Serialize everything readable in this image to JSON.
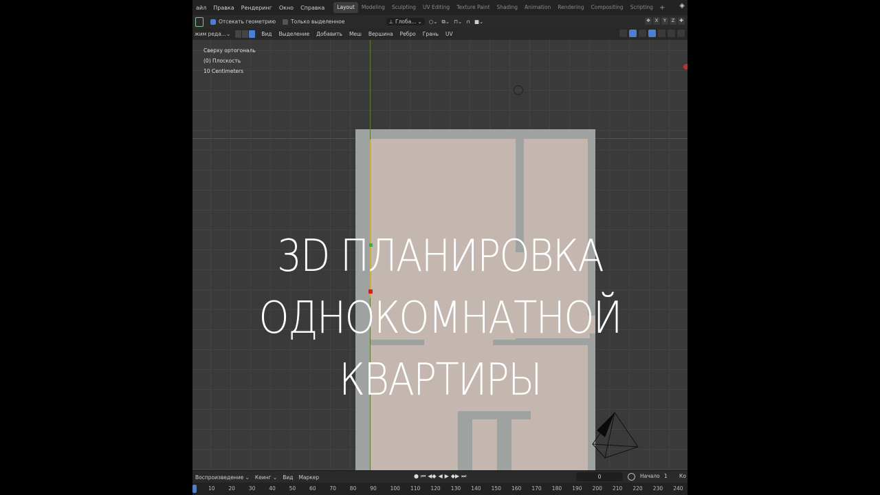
{
  "menubar": {
    "items": [
      "айл",
      "Правка",
      "Рендеринг",
      "Окно",
      "Справка"
    ],
    "workspaces": [
      "Layout",
      "Modeling",
      "Sculpting",
      "UV Editing",
      "Texture Paint",
      "Shading",
      "Animation",
      "Rendering",
      "Compositing",
      "Scripting"
    ],
    "active_workspace": "Layout",
    "add": "+"
  },
  "toolbar": {
    "clip_geometry": "Отсекать геометрию",
    "only_selected": "Только выделенное",
    "orientation": "Глоба..."
  },
  "viewport_header": {
    "mode": "жим реда...",
    "menus": [
      "Вид",
      "Выделение",
      "Добавить",
      "Меш",
      "Вершина",
      "Ребро",
      "Грань",
      "UV"
    ]
  },
  "viewport_info": {
    "view": "Сверху ортогональ",
    "object": "(0) Плоскость",
    "scale": "10 Centimeters"
  },
  "title": {
    "line1": "3D ПЛАНИРОВКА",
    "line2": "ОДНОКОМНАТНОЙ",
    "line3": "КВАРТИРЫ"
  },
  "timeline": {
    "menus": [
      "Воспроизведение",
      "Кеинг",
      "Вид",
      "Маркер"
    ],
    "current_frame": "0",
    "start_label": "Начало",
    "start_value": "1",
    "end_label": "Ко",
    "ticks": [
      "10",
      "20",
      "30",
      "40",
      "50",
      "60",
      "70",
      "80",
      "90",
      "100",
      "110",
      "120",
      "130",
      "140",
      "150",
      "160",
      "170",
      "180",
      "190",
      "200",
      "210",
      "220",
      "230",
      "240"
    ]
  },
  "colors": {
    "accent": "#4a7fd1",
    "floor": "#c3b7b0",
    "walls": "#9ea3a1",
    "x_axis": "#8a3a3a",
    "y_axis": "#5d7a2e"
  }
}
